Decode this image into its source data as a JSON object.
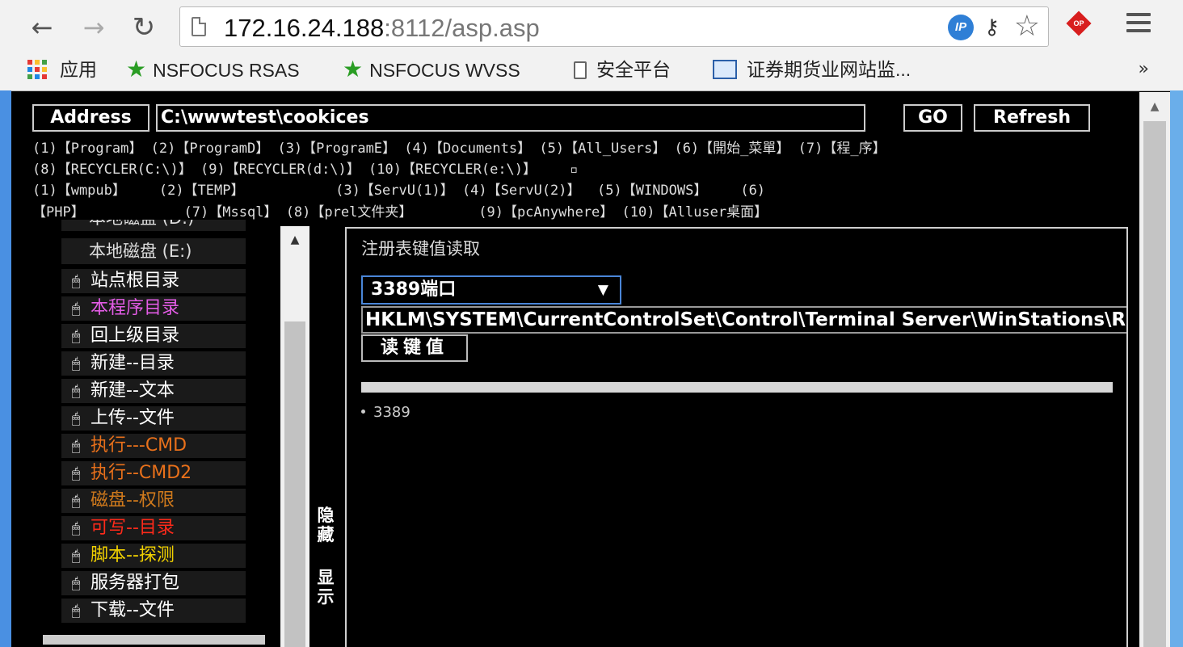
{
  "browser": {
    "url_host": "172.16.24.188",
    "url_port": ":8112",
    "url_path": "/asp.asp",
    "ip_badge": "IP",
    "icons": [
      "back-icon",
      "forward-icon",
      "reload-icon",
      "page-icon",
      "ip-badge-icon",
      "key-icon",
      "bookmark-star-icon",
      "extension-icon",
      "menu-icon"
    ],
    "bookmarks": [
      {
        "label": "应用",
        "icon": "apps-grid-icon"
      },
      {
        "label": "NSFOCUS RSAS",
        "icon": "green-star-icon"
      },
      {
        "label": "NSFOCUS WVSS",
        "icon": "green-star-icon"
      },
      {
        "label": "安全平台",
        "icon": "document-icon"
      },
      {
        "label": "证券期货业网站监...",
        "icon": "image-icon"
      }
    ],
    "more": "»"
  },
  "address_bar": {
    "label": "Address",
    "value": "C:\\wwwtest\\cookices",
    "go": "GO",
    "refresh": "Refresh"
  },
  "quick_paths": {
    "row1": [
      "(1)【Program】",
      "(2)【ProgramD】",
      "(3)【ProgramE】",
      "(4)【Documents】",
      "(5)【All_Users】",
      "(6)【開始_菜單】",
      "(7)【程_序】"
    ],
    "row2": [
      "(8)【RECYCLER(C:\\)】",
      "(9)【RECYCLER(d:\\)】",
      "(10)【RECYCLER(e:\\)】"
    ],
    "row3": [
      "(1)【wmpub】",
      "(2)【TEMP】",
      "(3)【ServU(1)】",
      "(4)【ServU(2)】",
      "(5)【WINDOWS】",
      "(6)"
    ],
    "row4": [
      "【PHP】",
      "(7)【Mssql】",
      "(8)【prel文件夹】",
      "(9)【pcAnywhere】",
      "(10)【Alluser桌面】"
    ]
  },
  "sidebar": {
    "disk_partial": "本地磁盘 (D:)",
    "disk_e": "本地磁盘 (E:)",
    "items": [
      {
        "label": "站点根目录",
        "color": "#ffffff"
      },
      {
        "label": "本程序目录",
        "color": "#e35ce6"
      },
      {
        "label": "回上级目录",
        "color": "#ffffff"
      },
      {
        "label": "新建--目录",
        "color": "#ffffff"
      },
      {
        "label": "新建--文本",
        "color": "#ffffff"
      },
      {
        "label": "上传--文件",
        "color": "#ffffff"
      },
      {
        "label": "执行---CMD",
        "color": "#e8701a"
      },
      {
        "label": "执行--CMD2",
        "color": "#e8701a"
      },
      {
        "label": "磁盘--权限",
        "color": "#d07a1c"
      },
      {
        "label": "可写--目录",
        "color": "#ff2a1a"
      },
      {
        "label": "脚本--探测",
        "color": "#f0d000"
      },
      {
        "label": "服务器打包",
        "color": "#ffffff"
      },
      {
        "label": "下载--文件",
        "color": "#ffffff"
      }
    ]
  },
  "toggle": {
    "hide": "隐藏",
    "show": "显示"
  },
  "panel": {
    "title": "注册表键值读取",
    "select_value": "3389端口",
    "select_arrow": "▼",
    "key_path": "HKLM\\SYSTEM\\CurrentControlSet\\Control\\Terminal Server\\WinStations\\RDP-Tcp\\PortNumber",
    "read_button": "读键值",
    "result": "3389"
  }
}
